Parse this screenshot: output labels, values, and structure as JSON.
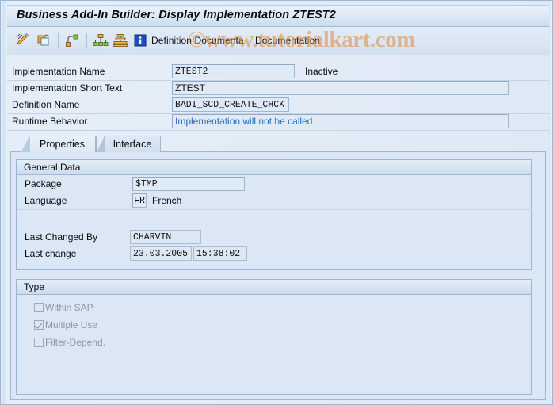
{
  "window": {
    "title": "Business Add-In Builder: Display Implementation ZTEST2"
  },
  "watermark": {
    "text": "©www.tutorialkart.com"
  },
  "toolbar": {
    "icons": [
      {
        "name": "display-change-pencil-icon"
      },
      {
        "name": "copy-icon"
      },
      {
        "name": "hierarchy-node-icon"
      },
      {
        "name": "org-structure-icon"
      },
      {
        "name": "stack-layers-icon"
      },
      {
        "name": "information-icon"
      }
    ],
    "buttons": [
      {
        "label": "Definition Documenta"
      },
      {
        "label": "Documentation"
      }
    ]
  },
  "header": {
    "fields": [
      {
        "label": "Implementation Name",
        "value": "ZTEST2",
        "status": "Inactive"
      },
      {
        "label": "Implementation Short Text",
        "value": "ZTEST"
      },
      {
        "label": "Definition Name",
        "value": "BADI_SCD_CREATE_CHCK"
      },
      {
        "label": "Runtime Behavior",
        "value": "Implementation will not be called"
      }
    ]
  },
  "tabs": [
    {
      "label": "Properties",
      "active": true
    },
    {
      "label": "Interface",
      "active": false
    }
  ],
  "general_data": {
    "title": "General Data",
    "package": {
      "label": "Package",
      "value": "$TMP"
    },
    "language": {
      "label": "Language",
      "code": "FR",
      "name": "French"
    },
    "last_changed_by": {
      "label": "Last Changed By",
      "value": "CHARVIN"
    },
    "last_change": {
      "label": "Last change",
      "date": "23.03.2005",
      "time": "15:38:02"
    }
  },
  "type_group": {
    "title": "Type",
    "options": [
      {
        "label": "Within SAP",
        "checked": false
      },
      {
        "label": "Multiple Use",
        "checked": true
      },
      {
        "label": "Filter-Depend.",
        "checked": false
      }
    ]
  },
  "colors": {
    "title_bar": "#c9dcee",
    "panel_bg": "#dbe7f4",
    "field_bg": "#dfeaf6",
    "field_border": "#9fb8d2",
    "runtime_text": "#2b6cb8",
    "watermark": "#e0944a",
    "disabled_text": "#8a98a8"
  }
}
